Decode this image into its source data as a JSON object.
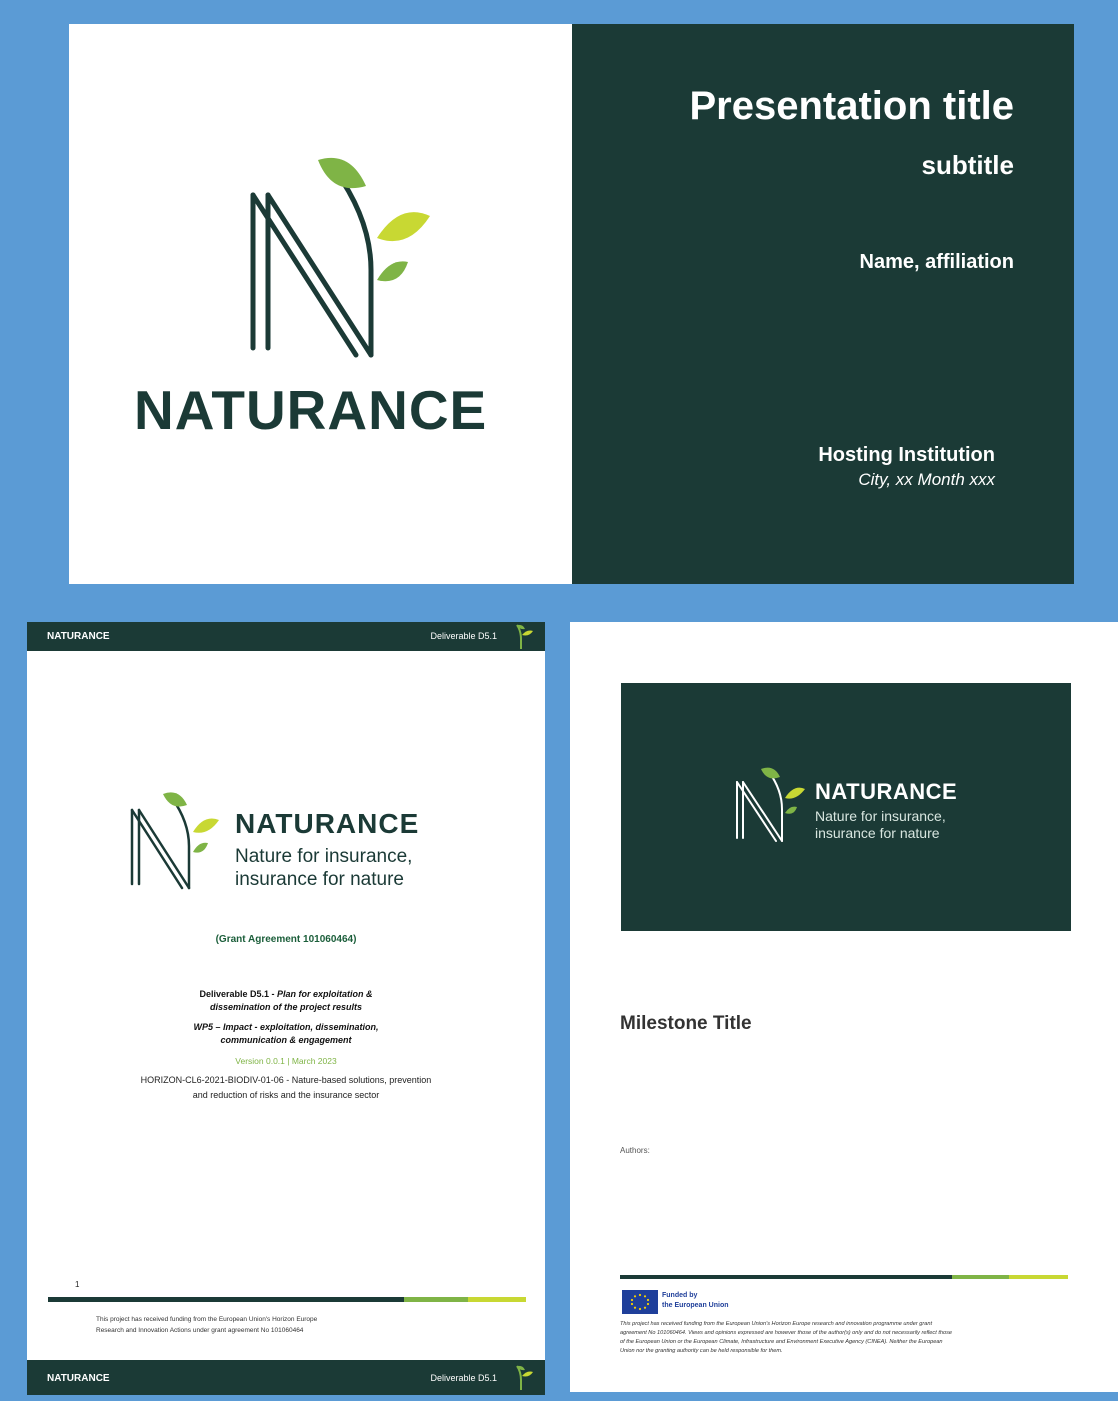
{
  "colors": {
    "brand_dark": "#1b3a36",
    "green": "#7fb446",
    "lime": "#c8d833",
    "leaf_dark": "#5aa02c",
    "frame": "#5b9bd5"
  },
  "slide": {
    "wordmark": "NATURANCE",
    "title": "Presentation title",
    "subtitle": "subtitle",
    "name": "Name,  affiliation",
    "institution": "Hosting Institution",
    "location": "City, xx Month xxx"
  },
  "deliverable": {
    "header_left": "NATURANCE",
    "header_right": "Deliverable D5.1",
    "wordmark": "NATURANCE",
    "tagline1": "Nature for insurance,",
    "tagline2": "insurance for nature",
    "grant": "(Grant Agreement 101060464)",
    "d_label": "Deliverable D5.1 - ",
    "d_title1": "Plan for exploitation &",
    "d_title2": "dissemination of the project results",
    "wp_label": "WP5 – Impact - exploitation, dissemination,",
    "wp_label2": "communication & engagement",
    "version": "Version 0.0.1  |  March 2023",
    "call1": "HORIZON-CL6-2021-BIODIV-01-06 - Nature-based solutions, prevention",
    "call2": "and reduction of risks and the insurance sector",
    "page_number": "1",
    "funding1": "This project has received funding from the European Union's Horizon Europe",
    "funding2": "Research and Innovation Actions under grant agreement No 101060464",
    "footer_left": "NATURANCE",
    "footer_right": "Deliverable D5.1"
  },
  "milestone": {
    "wordmark": "NATURANCE",
    "tagline1": "Nature for insurance,",
    "tagline2": "insurance for nature",
    "title": "Milestone Title",
    "authors": "Authors:",
    "funded1": "Funded by",
    "funded2": "the European Union",
    "disclaimer1": "This project has received funding from the European Union's Horizon Europe research and innovation programme under grant",
    "disclaimer2": "agreement No 101060464. Views and opinions expressed are however those of the author(s) only and do not necessarily reflect those",
    "disclaimer3": "of the European Union or the European Climate, Infrastructure and Environment Executive Agency (CINEA). Neither the European",
    "disclaimer4": "Union nor the granting authority can be held responsible for them."
  }
}
